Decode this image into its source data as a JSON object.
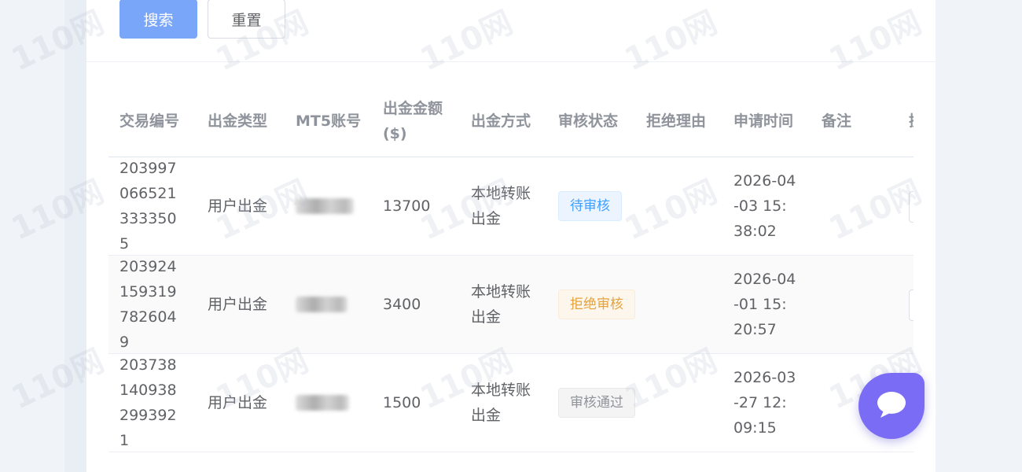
{
  "filters": {
    "search_label": "搜索",
    "reset_label": "重置"
  },
  "table": {
    "headers": [
      "交易编号",
      "出金类型",
      "MT5账号",
      "出金金额 ($)",
      "出金方式",
      "审核状态",
      "拒绝理由",
      "申请时间",
      "备注",
      "操"
    ],
    "rows": [
      {
        "id": "2039970665213333505",
        "type": "用户出金",
        "amount": "13700",
        "method": "本地转账出金",
        "status": "待审核",
        "reason": "",
        "time": "2026-04-03 15: 38:02",
        "note": ""
      },
      {
        "id": "2039241593197826049",
        "type": "用户出金",
        "amount": "3400",
        "method": "本地转账出金",
        "status": "拒绝审核",
        "reason": "",
        "time": "2026-04-01 15: 20:57",
        "note": ""
      },
      {
        "id": "2037381409382993921",
        "type": "用户出金",
        "amount": "1500",
        "method": "本地转账出金",
        "status": "审核通过",
        "reason": "",
        "time": "2026-03-27 12: 09:15",
        "note": ""
      }
    ]
  },
  "watermark": "110网",
  "colors": {
    "primary": "#79a6f8",
    "chat_button": "#7b6cf6",
    "pending": "#409eff",
    "rejected": "#e6a23c",
    "passed": "#909399"
  },
  "icons": {
    "chat": "chat-bubble-icon"
  }
}
